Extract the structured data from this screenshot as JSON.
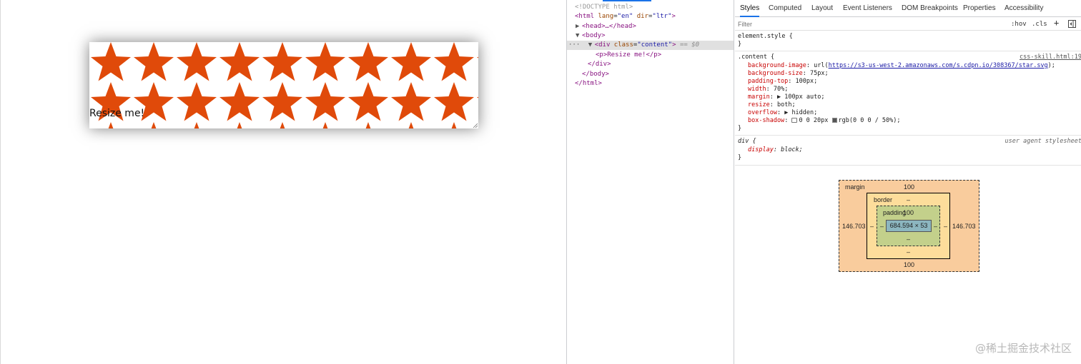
{
  "viewport": {
    "text": "Resize me!"
  },
  "elements_panel": {
    "doctype": "<!DOCTYPE html>",
    "html_open": "<html",
    "html_lang_attr": "lang",
    "html_lang_val": "\"en\"",
    "html_dir_attr": "dir",
    "html_dir_val": "\"ltr\"",
    "head": "<head>…</head>",
    "body_open": "<body>",
    "div_open": "<div",
    "div_class_attr": "class",
    "div_class_val": "\"content\"",
    "div_marker": "== $0",
    "p_line": "<p>Resize me!</p>",
    "div_close": "</div>",
    "body_close": "</body>",
    "html_close": "</html>"
  },
  "styles_tabs": [
    "Styles",
    "Computed",
    "Layout",
    "Event Listeners",
    "DOM Breakpoints",
    "Properties",
    "Accessibility"
  ],
  "filter": {
    "placeholder": "Filter",
    "hov": ":hov",
    "cls": ".cls",
    "plus": "+"
  },
  "rules": {
    "element_style": "element.style {",
    "close": "}",
    "content_selector": ".content {",
    "content_source": "css-skill.html:19",
    "content_props": [
      {
        "name": "background-image",
        "value": "url(",
        "link": "https://s3-us-west-2.amazonaws.com/s.cdpn.io/308367/star.svg",
        "tail": ");"
      },
      {
        "name": "background-size",
        "value": "75px;"
      },
      {
        "name": "padding-top",
        "value": "100px;"
      },
      {
        "name": "width",
        "value": "70%;"
      },
      {
        "name": "margin",
        "value": "▶ 100px auto;"
      },
      {
        "name": "resize",
        "value": "both;"
      },
      {
        "name": "overflow",
        "value": "▶ hidden;"
      },
      {
        "name": "box-shadow",
        "value": "0 0 20px",
        "value2": "rgb(0 0 0 / 50%);"
      }
    ],
    "div_selector": "div {",
    "div_source": "user agent stylesheet",
    "div_prop_name": "display",
    "div_prop_value": "block;"
  },
  "box_model": {
    "margin_label": "margin",
    "margin_top": "100",
    "margin_bottom": "100",
    "margin_left": "146.703",
    "margin_right": "146.703",
    "border_label": "border",
    "border_top": "–",
    "border_bottom": "–",
    "border_left": "–",
    "border_right": "–",
    "padding_label": "padding",
    "padding_top": "100",
    "padding_bottom": "–",
    "padding_left": "–",
    "padding_right": "–",
    "content_size": "684.594 × 53"
  },
  "watermark": "@稀土掘金技术社区"
}
